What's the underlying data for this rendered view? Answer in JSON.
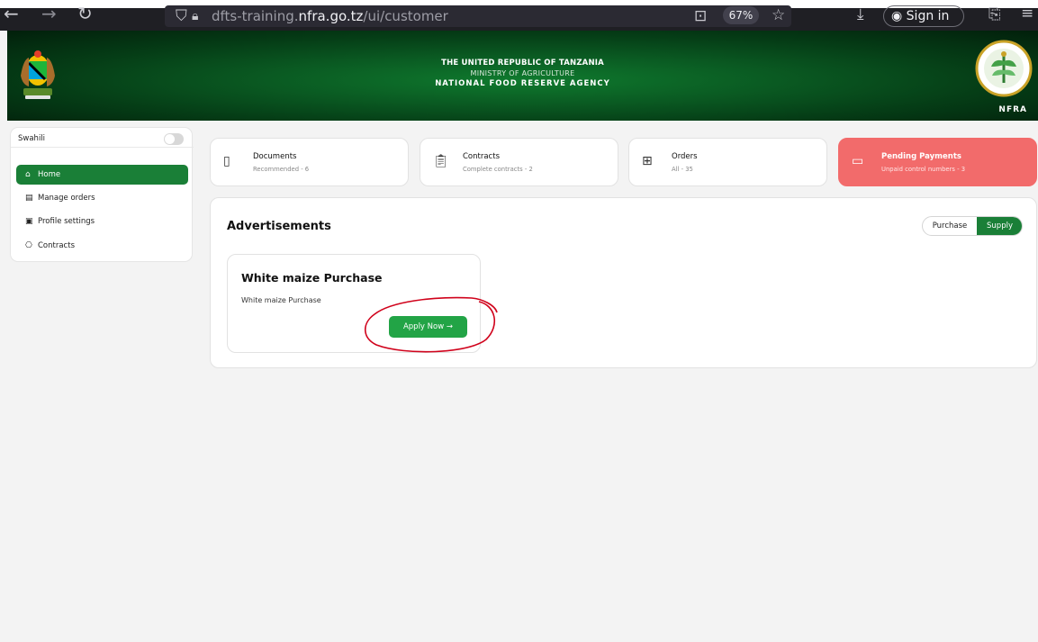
{
  "browser": {
    "url_prefix": "dfts-training.",
    "url_domain": "nfra.go.tz",
    "url_path": "/ui/customer",
    "zoom": "67%",
    "signin_label": "Sign in"
  },
  "banner": {
    "line1": "THE UNITED REPUBLIC OF TANZANIA",
    "line2": "MINISTRY OF AGRICULTURE",
    "line3": "NATIONAL FOOD RESERVE AGENCY",
    "logo_label": "NFRA"
  },
  "sidebar": {
    "language": "Swahili",
    "items": [
      {
        "label": "Home",
        "icon": "home-icon"
      },
      {
        "label": "Manage orders",
        "icon": "orders-icon"
      },
      {
        "label": "Profile settings",
        "icon": "profile-icon"
      },
      {
        "label": "Contracts",
        "icon": "contracts-icon"
      }
    ]
  },
  "stats": [
    {
      "title": "Documents",
      "sub": "Recommended - 6",
      "icon": "document-icon"
    },
    {
      "title": "Contracts",
      "sub": "Complete contracts - 2",
      "icon": "clipboard-icon"
    },
    {
      "title": "Orders",
      "sub": "All - 35",
      "icon": "grid-icon"
    },
    {
      "title": "Pending Payments",
      "sub": "Unpaid control numbers - 3",
      "icon": "payment-icon"
    }
  ],
  "ads": {
    "title": "Advertisements",
    "filter_purchase": "Purchase",
    "filter_supply": "Supply",
    "card": {
      "title": "White maize Purchase",
      "description": "White maize Purchase",
      "button": "Apply Now →"
    }
  },
  "colors": {
    "primary_green": "#1a7f37",
    "button_green": "#22a446",
    "alert_red": "#f26b6b",
    "annotation_red": "#d0021b"
  }
}
